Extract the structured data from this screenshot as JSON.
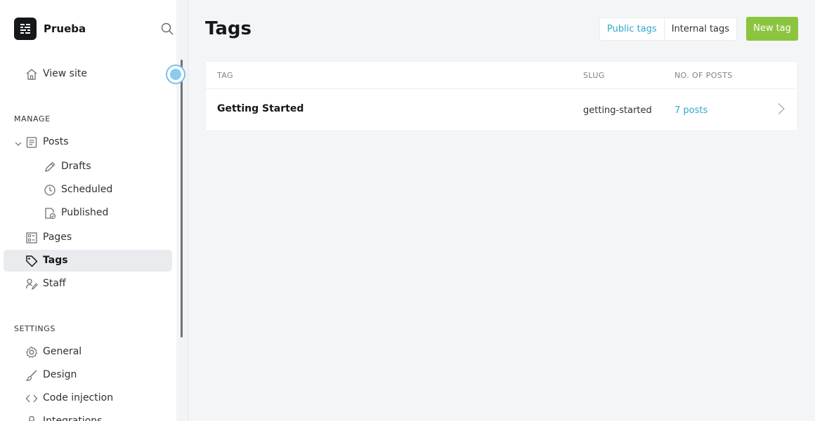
{
  "site": {
    "title": "Prueba"
  },
  "sidebar": {
    "view_site": "View site",
    "manage_label": "MANAGE",
    "posts": "Posts",
    "drafts": "Drafts",
    "scheduled": "Scheduled",
    "published": "Published",
    "pages": "Pages",
    "tags": "Tags",
    "staff": "Staff",
    "settings_label": "SETTINGS",
    "general": "General",
    "design": "Design",
    "code_injection": "Code injection",
    "integrations": "Integrations"
  },
  "main": {
    "title": "Tags",
    "tabs": [
      "Public tags",
      "Internal tags"
    ],
    "new_tag": "New tag",
    "table": {
      "headers": {
        "tag": "TAG",
        "slug": "SLUG",
        "posts": "NO. OF POSTS"
      },
      "rows": [
        {
          "name": "Getting Started",
          "slug": "getting-started",
          "count": "7 posts"
        }
      ]
    }
  },
  "colors": {
    "accent": "#30a7c9",
    "primary_button": "#8bc53f",
    "active_nav": "#e9ebee"
  }
}
